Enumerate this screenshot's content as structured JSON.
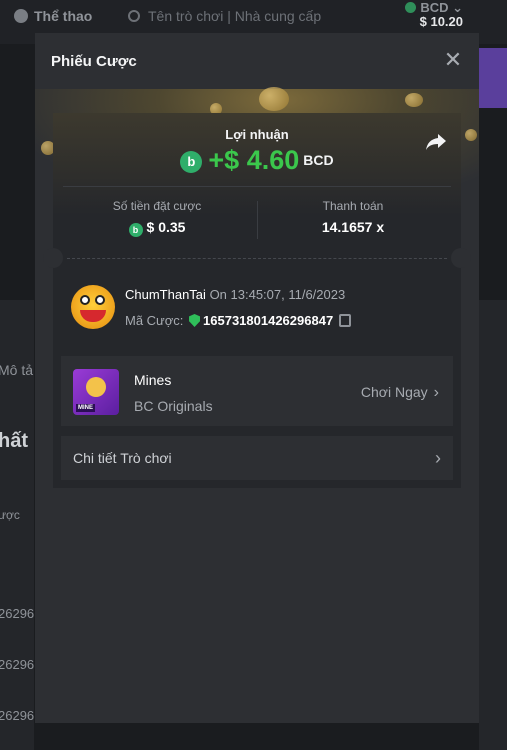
{
  "background": {
    "nav_sports": "Thể thao",
    "search_placeholder": "Tên trò chơi | Nhà cung cấp",
    "wallet_currency": "BCD",
    "wallet_balance": "$ 10.20",
    "side_texts": [
      "Mô tả",
      "hất",
      "ược",
      "26296",
      "26296",
      "26296"
    ]
  },
  "modal": {
    "title": "Phiếu Cược",
    "close_icon": "close-icon",
    "profit": {
      "label": "Lợi nhuận",
      "amount": "+$ 4.60",
      "currency": "BCD",
      "share_icon": "share-icon"
    },
    "stats": {
      "bet_label": "Số tiền đặt cược",
      "bet_value": "$ 0.35",
      "payout_label": "Thanh toán",
      "payout_value": "14.1657 x"
    },
    "user": {
      "name": "ChumThanTai",
      "time": "On 13:45:07, 11/6/2023",
      "bet_id_label": "Mã Cược:",
      "bet_id": "165731801426296847"
    },
    "game": {
      "name": "Mines",
      "provider": "BC Originals",
      "thumb_label": "MINE",
      "play_label": "Chơi Ngay"
    },
    "detail": {
      "label": "Chi tiết Trò chơi"
    }
  }
}
